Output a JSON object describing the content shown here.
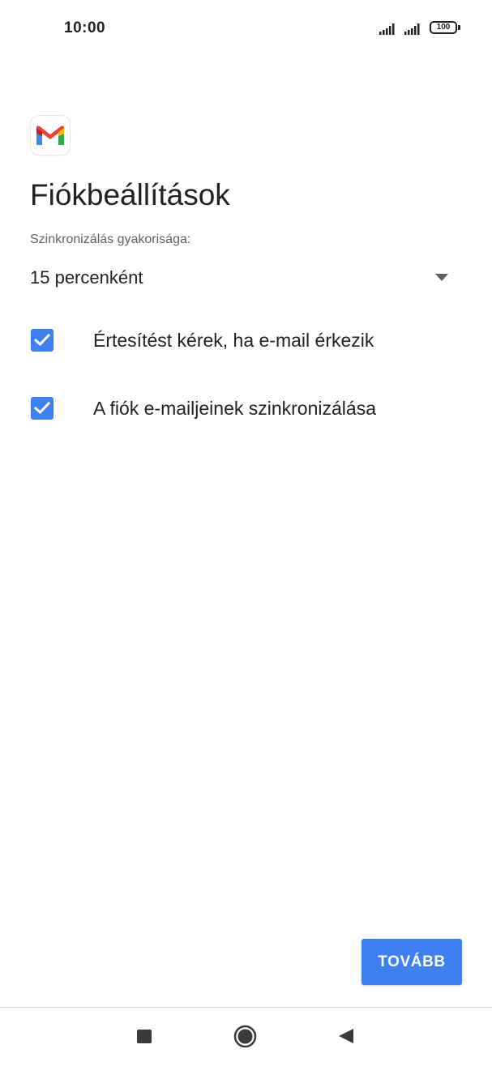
{
  "status_bar": {
    "time": "10:00",
    "battery_level": "100"
  },
  "app_icon": "gmail-logo",
  "title": "Fiókbeállítások",
  "sync_frequency": {
    "label": "Szinkronizálás gyakorisága:",
    "selected": "15 percenként"
  },
  "options": [
    {
      "label": "Értesítést kérek, ha e-mail érkezik",
      "checked": true
    },
    {
      "label": "A fiók e-mailjeinek szinkronizálása",
      "checked": true
    }
  ],
  "next_button": "TOVÁBB",
  "nav_bar": {
    "icons": [
      "recent-apps-icon",
      "home-icon",
      "back-icon"
    ]
  },
  "colors": {
    "accent": "#3f80f0",
    "text_primary": "#202124",
    "text_secondary": "#5f6368"
  }
}
